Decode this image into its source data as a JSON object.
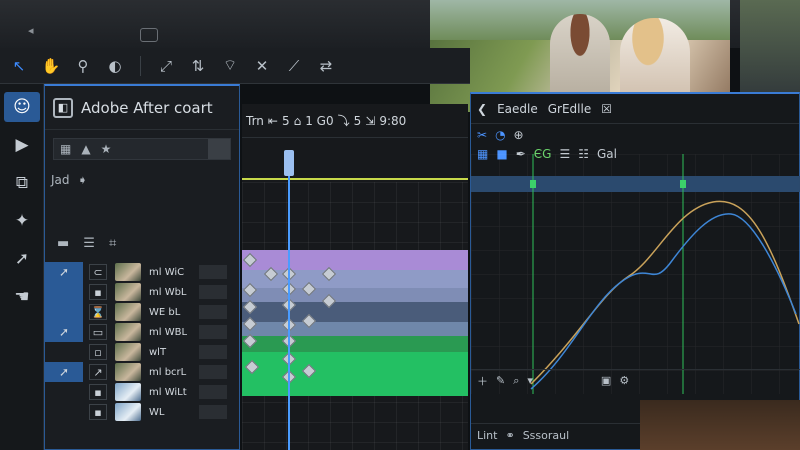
{
  "window": {
    "title": "Adobe After coart"
  },
  "toolbar": {
    "icons": [
      "selection-icon",
      "hand-icon",
      "zoom-icon",
      "pen-icon",
      "anchor-icon",
      "puppet-icon",
      "roto-icon",
      "pin-icon",
      "shape-icon"
    ]
  },
  "toolcolumn": {
    "tools": [
      "person-icon",
      "play-icon",
      "copy-icon",
      "pin-icon",
      "arrow-icon",
      "hand-icon"
    ]
  },
  "project": {
    "search_prefix": "Jad",
    "layers": [
      {
        "name": "ml WiC"
      },
      {
        "name": "ml WbL"
      },
      {
        "name": "WE bL"
      },
      {
        "name": "ml WBL"
      },
      {
        "name": "wlT"
      },
      {
        "name": "ml bcrL"
      },
      {
        "name": "ml WiLt"
      },
      {
        "name": "WL"
      }
    ]
  },
  "timeline": {
    "header": {
      "trim": "Trn",
      "val1": "5",
      "val2": "1 G0",
      "val3": "5",
      "val4": "9:80"
    }
  },
  "graph": {
    "tabs": [
      "Eaedle",
      "GrEdlle"
    ],
    "toolbar_label": "ЄG",
    "toolbar_btn": "Gal",
    "footer_label": "Lint",
    "footer_label2": "Sssoraul"
  },
  "colors": {
    "accent": "#3a7bd5",
    "curve_orange": "#c9a25a",
    "curve_blue": "#3e86d6",
    "workarea": "#c8d94a"
  }
}
